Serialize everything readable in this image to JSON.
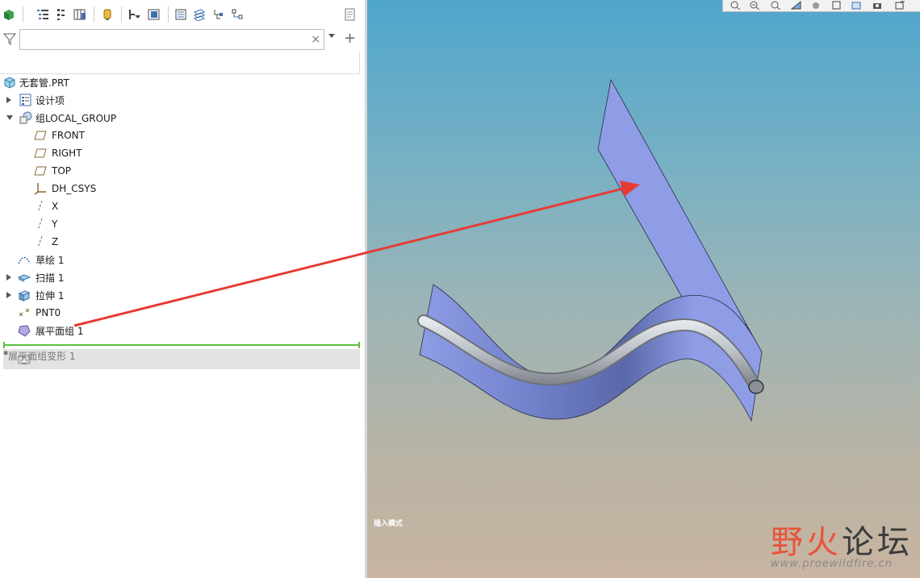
{
  "model_tree": {
    "search": {
      "placeholder": "",
      "value": "",
      "clear": "×"
    },
    "add": "+",
    "items": [
      {
        "label": "无套管.PRT"
      },
      {
        "label": "设计项"
      },
      {
        "label": "组LOCAL_GROUP"
      },
      {
        "label": "FRONT"
      },
      {
        "label": "RIGHT"
      },
      {
        "label": "TOP"
      },
      {
        "label": "DH_CSYS"
      },
      {
        "label": "X"
      },
      {
        "label": "Y"
      },
      {
        "label": "Z"
      },
      {
        "label": "草绘 1"
      },
      {
        "label": "扫描 1"
      },
      {
        "label": "拉伸 1"
      },
      {
        "label": "PNT0"
      },
      {
        "label": "展平面组 1"
      },
      {
        "label": "展平面组变形 1"
      }
    ]
  },
  "viewport": {
    "mode_label": "插入模式",
    "watermark": {
      "part1": "野火",
      "part2": "论坛",
      "url": "www.proewildfire.cn"
    },
    "colors": {
      "surface": "#8e9de6",
      "pipe": "#b8bec4",
      "annotation_arrow": "#e63a35"
    }
  },
  "icons": [
    "cube-icon",
    "list-tree-icon",
    "columns-icon",
    "table-icon",
    "bulb-icon",
    "filter-tree-icon",
    "layers-icon",
    "settings-tree-icon",
    "funnel-icon"
  ]
}
